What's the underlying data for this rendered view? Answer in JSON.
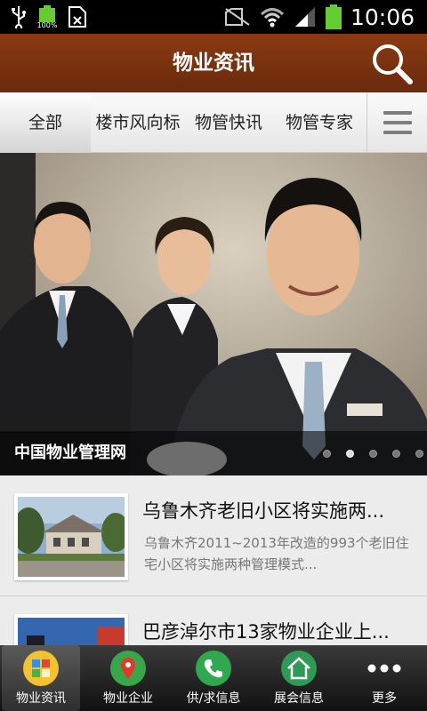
{
  "status_bar": {
    "battery_small_label": "100%",
    "time": "10:06",
    "icons": [
      "usb-icon",
      "battery-icon",
      "sim-icon",
      "no-sim-icon",
      "wifi-icon",
      "signal-icon",
      "battery-icon"
    ]
  },
  "header": {
    "title": "物业资讯",
    "search_icon": "search-icon"
  },
  "tabs": [
    {
      "label": "全部",
      "active": true
    },
    {
      "label": "楼市风向标",
      "active": false
    },
    {
      "label": "物管快讯",
      "active": false
    },
    {
      "label": "物管专家",
      "active": false
    }
  ],
  "banner": {
    "caption": "中国物业管理网",
    "slide_count": 5,
    "current_slide": 2
  },
  "news": [
    {
      "title": "乌鲁木齐老旧小区将实施两...",
      "description": "乌鲁木齐2011~2013年改造的993个老旧住宅小区将实施两种管理模式..."
    },
    {
      "title": "巴彦淖尔市13家物业企业上...",
      "description": ""
    }
  ],
  "bottom_nav": [
    {
      "label": "物业资讯",
      "icon": "puzzle-icon",
      "color": "#f2c230",
      "active": true
    },
    {
      "label": "物业企业",
      "icon": "map-pin-icon",
      "color": "#3aa64a",
      "active": false
    },
    {
      "label": "供/求信息",
      "icon": "phone-icon",
      "color": "#2fa84f",
      "active": false
    },
    {
      "label": "展会信息",
      "icon": "house-icon",
      "color": "#2f9a56",
      "active": false
    },
    {
      "label": "更多",
      "icon": "more-dots-icon",
      "color": "#ffffff",
      "active": false
    }
  ],
  "colors": {
    "header_brown": "#7a3210",
    "status_green": "#66cc33"
  }
}
